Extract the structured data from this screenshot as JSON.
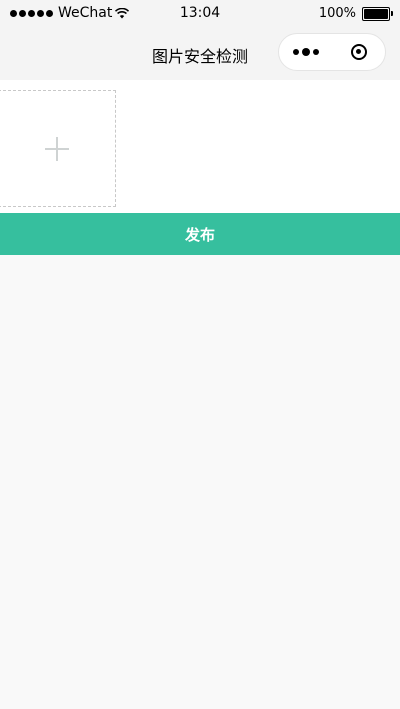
{
  "status_bar": {
    "carrier": "WeChat",
    "time": "13:04",
    "battery": "100%",
    "battery_level": 1.0
  },
  "nav": {
    "title": "图片安全检测"
  },
  "upload": {
    "icon": "plus-icon"
  },
  "publish": {
    "label": "发布",
    "color": "#36bf9e"
  },
  "colors": {
    "background": "#f9f9f9",
    "accent": "#36bf9e"
  }
}
